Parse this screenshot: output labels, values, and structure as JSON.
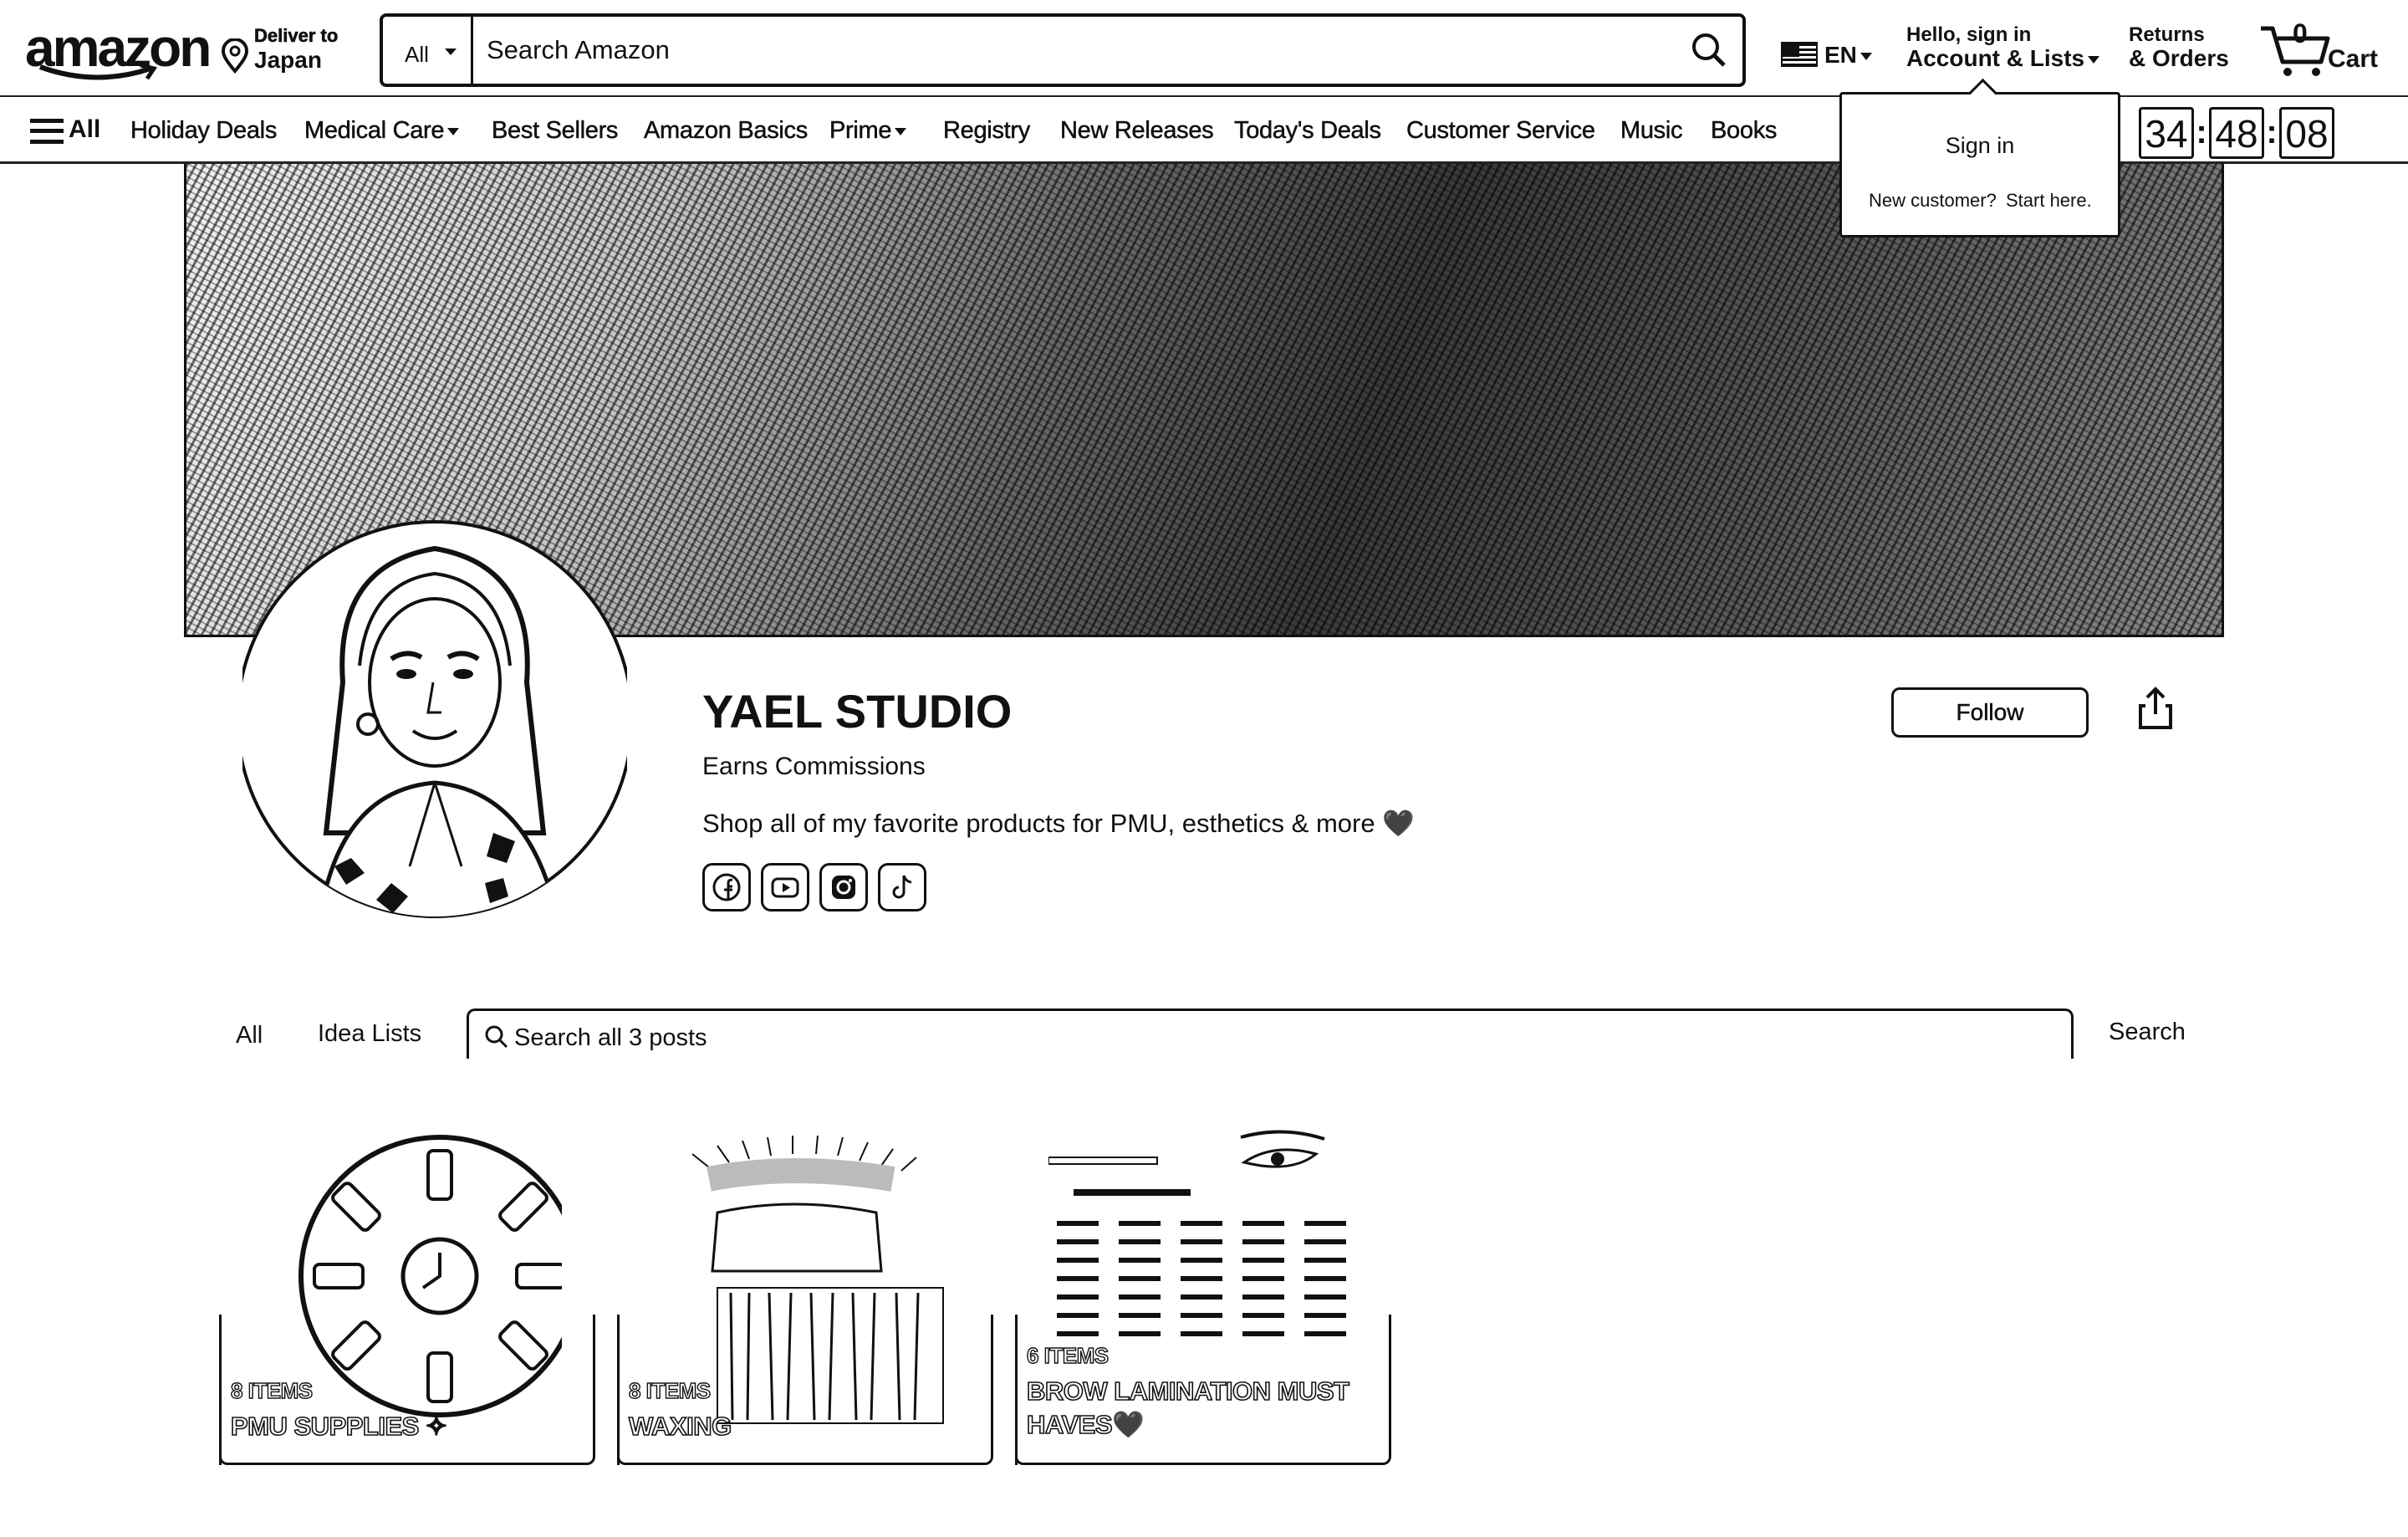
{
  "header": {
    "logo_text": "amazon",
    "deliver_line1": "Deliver to",
    "deliver_line2": "Japan",
    "search_category": "All",
    "search_placeholder": "Search Amazon",
    "language": "EN",
    "account_line1": "Hello, sign in",
    "account_line2": "Account & Lists",
    "returns_line1": "Returns",
    "returns_line2": "& Orders",
    "cart_count": "0",
    "cart_label": "Cart"
  },
  "nav": {
    "all_label": "All",
    "items": [
      "Holiday Deals",
      "Medical Care",
      "Best Sellers",
      "Amazon Basics",
      "Prime",
      "Registry",
      "New Releases",
      "Today's Deals",
      "Customer Service",
      "Music",
      "Books"
    ],
    "timer": [
      "34",
      "48",
      "08"
    ]
  },
  "signin_popup": {
    "sign_in": "Sign in",
    "new_customer": "New customer?",
    "start_here": "Start here."
  },
  "profile": {
    "name": "YAEL STUDIO",
    "earns": "Earns Commissions",
    "bio": "Shop all of my favorite products for PMU, esthetics & more 🖤",
    "follow_label": "Follow",
    "socials": [
      "facebook-icon",
      "youtube-icon",
      "instagram-icon",
      "tiktok-icon"
    ]
  },
  "tabs": {
    "all": "All",
    "idea_lists": "Idea Lists",
    "search_placeholder": "Search all 3 posts",
    "search_button": "Search"
  },
  "cards": [
    {
      "items": "8 ITEMS",
      "title": "PMU SUPPLIES ✧"
    },
    {
      "items": "8 ITEMS",
      "title": "WAXING"
    },
    {
      "items": "6 ITEMS",
      "title": "BROW LAMINATION MUST HAVES🖤"
    }
  ]
}
